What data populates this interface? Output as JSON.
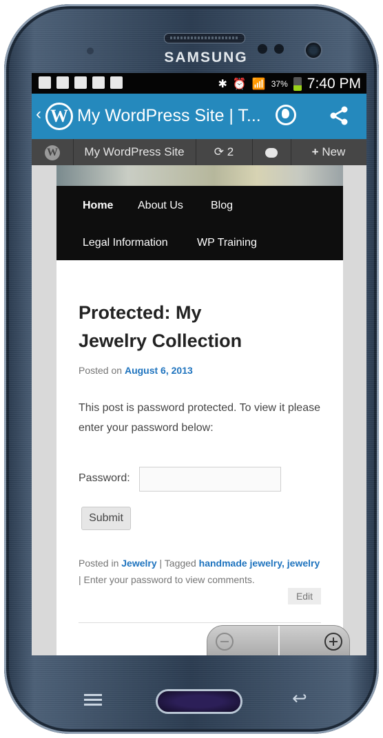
{
  "device": {
    "brand": "SAMSUNG"
  },
  "status_bar": {
    "battery": "37%",
    "time": "7:40 PM"
  },
  "app_bar": {
    "title": "My WordPress Site | T...",
    "back_icon": "chevron-left-icon",
    "globe_icon": "globe-icon",
    "share_icon": "share-icon"
  },
  "admin_bar": {
    "site_label": "My WordPress Site",
    "updates_count": "2",
    "new_label": "New"
  },
  "nav": {
    "items": [
      "Home",
      "About Us",
      "Blog",
      "Legal Information",
      "WP Training"
    ]
  },
  "post": {
    "title_line1": "Protected: My",
    "title_line2": "Jewelry Collection",
    "posted_on_label": "Posted on",
    "date": "August 6, 2013",
    "body": "This post is password protected. To view it please enter your password below:",
    "password_label": "Password:",
    "password_value": "",
    "submit_label": "Submit",
    "posted_in_label": "Posted in",
    "category": "Jewelry",
    "tagged_label": "| Tagged",
    "tag1": "handmade jewelry,",
    "tag2": "jewelry",
    "footer_tail": "| Enter your password to view comments.",
    "edit_label": "Edit"
  },
  "colors": {
    "app_bar": "#2589bd",
    "admin_bar": "#464646",
    "link": "#1e73be",
    "nav_bg": "#0e0e0e"
  }
}
